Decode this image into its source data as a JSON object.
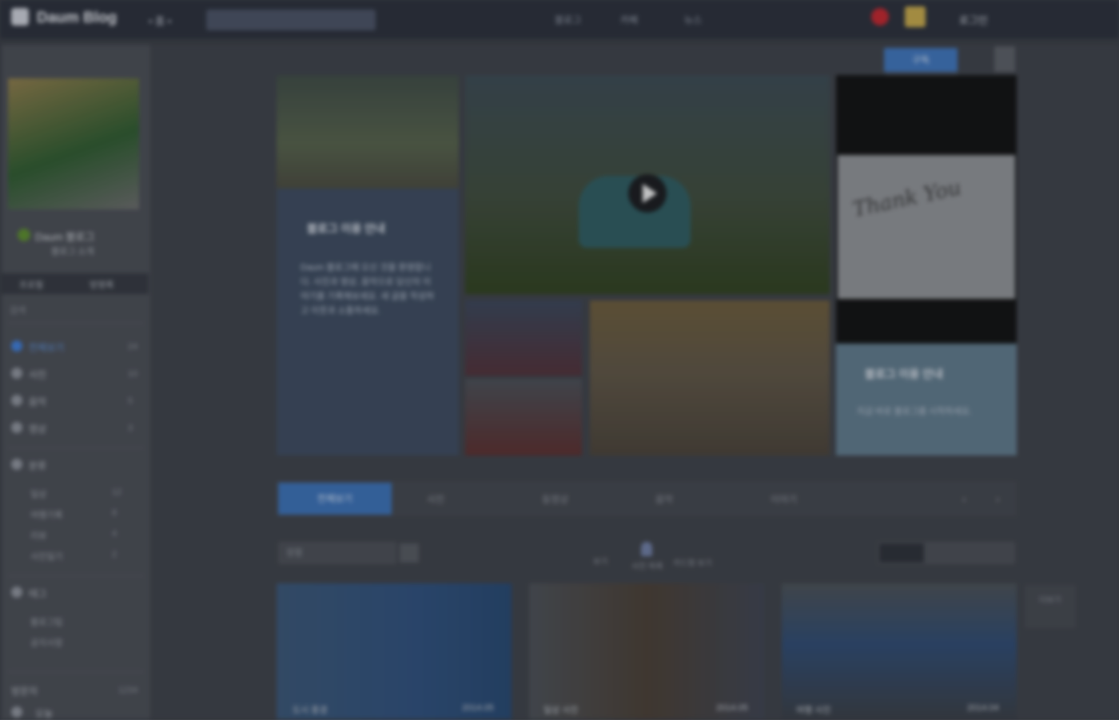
{
  "header": {
    "brand": "Daum Blog",
    "brand_sub": "• 홈 •",
    "search_placeholder": "",
    "nav": [
      "블로그",
      "카페",
      "뉴스"
    ],
    "login": "로그인"
  },
  "sidebar": {
    "profile_name": "Daum 블로그",
    "profile_sub": "블로그 소개",
    "tabs": [
      "프로필",
      "방명록"
    ],
    "search_placeholder": "검색",
    "menu": [
      {
        "label": "전체보기",
        "count": "24"
      },
      {
        "label": "사진",
        "count": "10"
      },
      {
        "label": "음악",
        "count": "5"
      },
      {
        "label": "영상",
        "count": "3"
      }
    ],
    "section": "분류",
    "sub_items": [
      {
        "label": "일상",
        "count": "12"
      },
      {
        "label": "여행기록",
        "count": "8"
      },
      {
        "label": "리뷰",
        "count": "4"
      },
      {
        "label": "사진일기",
        "count": "2"
      }
    ],
    "section2": "태그",
    "sub_items2": [
      "블로그팁",
      "공지사항"
    ],
    "footer_left": "방문자",
    "footer_right": "1234",
    "footer_item": "오늘"
  },
  "main": {
    "share_button": "구독",
    "mosaic": {
      "block1_title": "블로그 이용 안내",
      "block1_text": "Daum 블로그에 오신 것을 환영합니다. 사진과 영상, 음악으로 당신의 이야기를 기록해보세요. 새 글을 작성하고 이웃과 소통하세요.",
      "note_text": "Thank You",
      "block2_title": "블로그 이용 안내",
      "block2_text": "지금 바로 블로그를 시작하세요."
    },
    "tabs": [
      "전체보기",
      "사진",
      "동영상",
      "음악",
      "이야기"
    ],
    "filter_placeholder": "정렬",
    "mid_label_1": "보기",
    "mid_label_2": "사진 목록",
    "mid_label_3": "카드형 보기",
    "cards": [
      {
        "label_left": "도시 풍경",
        "label_right": "2014.05"
      },
      {
        "label_left": "일상 사진",
        "label_right": "2014.05"
      },
      {
        "label_left": "여행 사진",
        "label_right": "2014.04"
      }
    ],
    "side_widget": "더보기"
  },
  "colors": {
    "accent": "#3b6fb3",
    "topbar": "#2b2f3a",
    "record": "#c0262e"
  }
}
